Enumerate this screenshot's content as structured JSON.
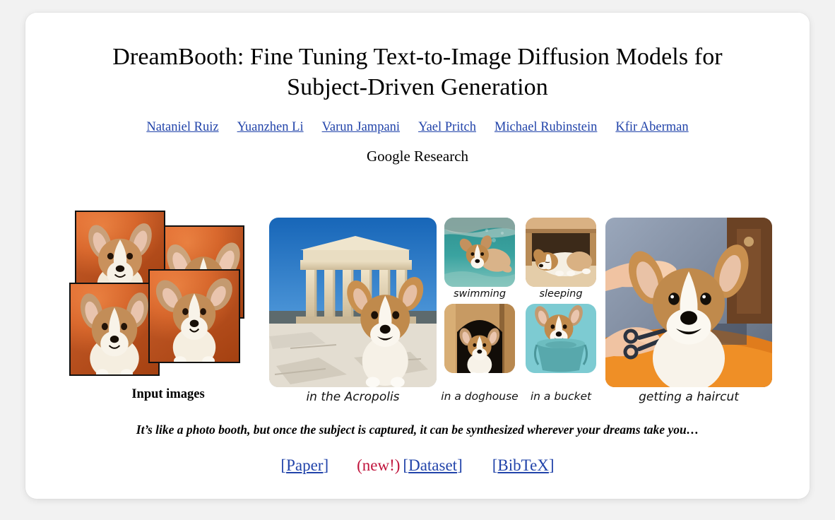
{
  "paper": {
    "title_line1": "DreamBooth: Fine Tuning Text-to-Image Diffusion Models for",
    "title_line2": "Subject-Driven Generation",
    "affiliation": "Google Research"
  },
  "authors": [
    {
      "name": "Nataniel Ruiz"
    },
    {
      "name": "Yuanzhen Li"
    },
    {
      "name": "Varun Jampani"
    },
    {
      "name": "Yael Pritch"
    },
    {
      "name": "Michael Rubinstein"
    },
    {
      "name": "Kfir Aberman"
    }
  ],
  "figure": {
    "input_label": "Input images",
    "captions": {
      "acropolis": "in the Acropolis",
      "swimming": "swimming",
      "sleeping": "sleeping",
      "doghouse": "in a doghouse",
      "bucket": "in a bucket",
      "haircut": "getting a haircut"
    }
  },
  "footer": {
    "tagline": "It’s like a photo booth, but once the subject is captured, it can be synthesized wherever your dreams take you…",
    "paper_link": "Paper",
    "new_badge": "(new!)",
    "dataset_link": "Dataset",
    "bibtex_link": "BibTeX"
  },
  "colors": {
    "link": "#2244aa",
    "new_badge": "#c0143c",
    "page_bg": "#f2f2f2",
    "card_bg": "#ffffff",
    "backdrop_orange": "#e2621f"
  }
}
